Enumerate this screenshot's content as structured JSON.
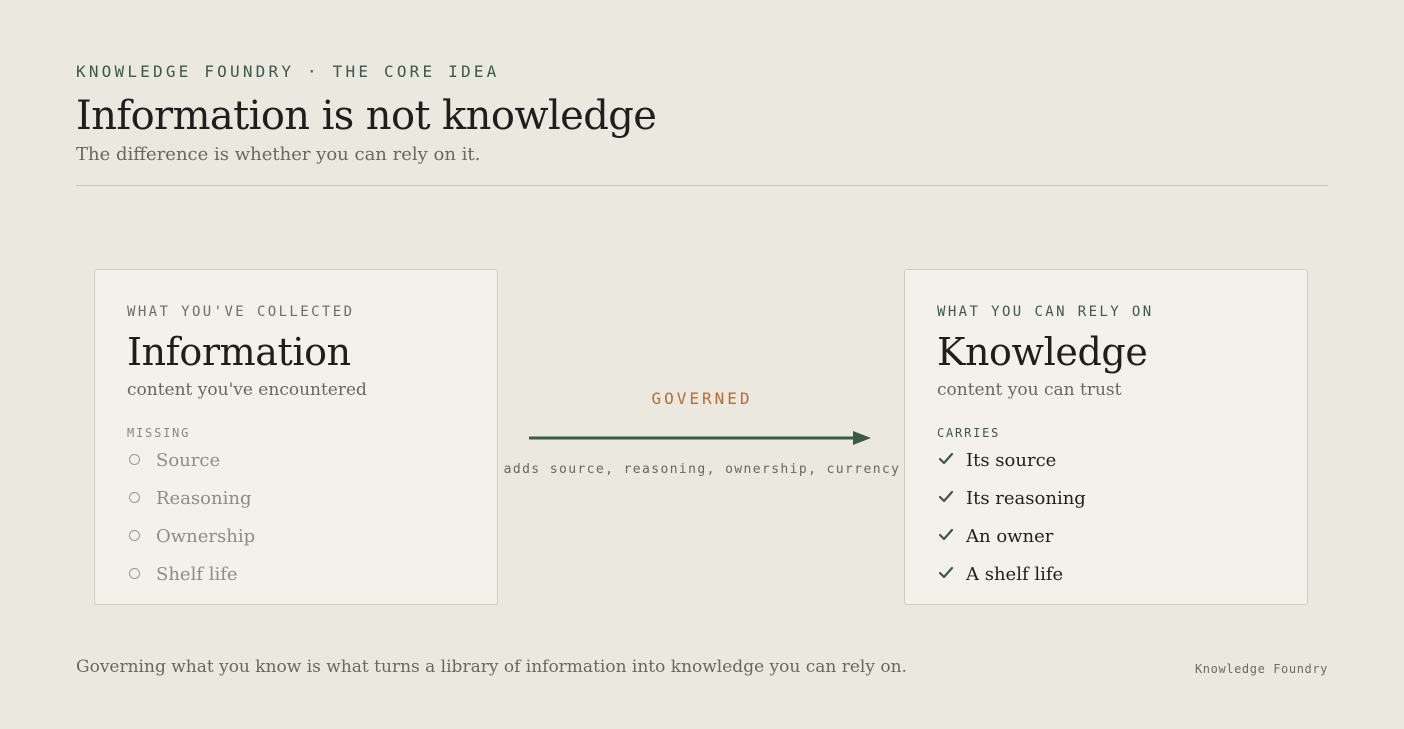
{
  "header": {
    "eyebrow": "KNOWLEDGE FOUNDRY · THE CORE IDEA",
    "title": "Information is not knowledge",
    "subtitle": "The difference is whether you can rely on it."
  },
  "left_card": {
    "eyebrow": "WHAT YOU'VE COLLECTED",
    "title": "Information",
    "subtitle": "content you've encountered",
    "list_label": "MISSING",
    "items": [
      "Source",
      "Reasoning",
      "Ownership",
      "Shelf life"
    ]
  },
  "right_card": {
    "eyebrow": "WHAT YOU CAN RELY ON",
    "title": "Knowledge",
    "subtitle": "content you can trust",
    "list_label": "CARRIES",
    "items": [
      "Its source",
      "Its reasoning",
      "An owner",
      "A shelf life"
    ]
  },
  "arrow": {
    "label": "GOVERNED",
    "caption": "adds source, reasoning, ownership, currency"
  },
  "footer": {
    "text": "Governing what you know is what turns a library of information into knowledge you can rely on.",
    "brand": "Knowledge Foundry"
  },
  "colors": {
    "background": "#ebe8e0",
    "card": "#f3f1ea",
    "accent_green": "#3b5a4a",
    "accent_orange": "#b96b33"
  },
  "icons": {
    "missing_marker": "empty-circle-icon",
    "carries_marker": "check-icon",
    "arrow": "right-arrow-icon"
  }
}
